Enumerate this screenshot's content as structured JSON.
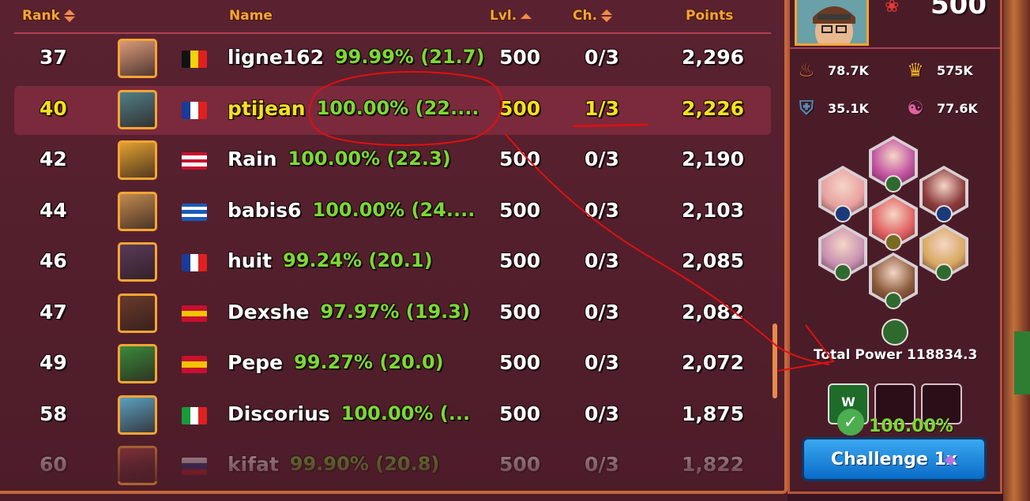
{
  "headers": {
    "rank": "Rank",
    "name": "Name",
    "level": "Lvl.",
    "challenges": "Ch.",
    "points": "Points"
  },
  "rows": [
    {
      "rank": "37",
      "name": "ligne162",
      "stat": "99.99% (21.7)",
      "level": "500",
      "challenges": "0/3",
      "points": "2,296",
      "flag": "be",
      "avatar_color": "#d89a7a",
      "highlight": false
    },
    {
      "rank": "40",
      "name": "ptijean",
      "stat": "100.00% (22....",
      "level": "500",
      "challenges": "1/3",
      "points": "2,226",
      "flag": "fr",
      "avatar_color": "#4f7f86",
      "highlight": true
    },
    {
      "rank": "42",
      "name": "Rain",
      "stat": "100.00% (22.3)",
      "level": "500",
      "challenges": "0/3",
      "points": "2,190",
      "flag": "my",
      "avatar_color": "#e0a030",
      "highlight": false
    },
    {
      "rank": "44",
      "name": "babis6",
      "stat": "100.00% (24....",
      "level": "500",
      "challenges": "0/3",
      "points": "2,103",
      "flag": "gr",
      "avatar_color": "#c08a50",
      "highlight": false
    },
    {
      "rank": "46",
      "name": "huit",
      "stat": "99.24% (20.1)",
      "level": "500",
      "challenges": "0/3",
      "points": "2,085",
      "flag": "fr",
      "avatar_color": "#5a3a5a",
      "highlight": false
    },
    {
      "rank": "47",
      "name": "Dexshe",
      "stat": "97.97% (19.3)",
      "level": "500",
      "challenges": "0/3",
      "points": "2,082",
      "flag": "es",
      "avatar_color": "#6a3a2a",
      "highlight": false
    },
    {
      "rank": "49",
      "name": "Pepe",
      "stat": "99.27% (20.0)",
      "level": "500",
      "challenges": "0/3",
      "points": "2,072",
      "flag": "es",
      "avatar_color": "#3a8a3a",
      "highlight": false
    },
    {
      "rank": "58",
      "name": "Discorius",
      "stat": "100.00% (...",
      "level": "500",
      "challenges": "0/3",
      "points": "1,875",
      "flag": "it",
      "avatar_color": "#5aa0c0",
      "highlight": false
    },
    {
      "rank": "60",
      "name": "kifat",
      "stat": "99.90% (20.8)",
      "level": "500",
      "challenges": "0/3",
      "points": "1,822",
      "flag": "ru",
      "avatar_color": "#b04a4a",
      "highlight": false
    }
  ],
  "profile": {
    "level": "500",
    "stats": [
      {
        "icon": "ego-icon",
        "value": "78.7K"
      },
      {
        "icon": "crown-icon",
        "value": "575K"
      },
      {
        "icon": "defense-icon",
        "value": "35.1K"
      },
      {
        "icon": "harmony-icon",
        "value": "77.6K"
      }
    ],
    "total_power": "Total Power 118834.3",
    "slot_label": "W",
    "win_chance": "100.00%",
    "challenge_label": "Challenge 1x"
  },
  "colors": {
    "accent": "#f6a534",
    "stat_green": "#7bd935",
    "highlight_text": "#f3e21a",
    "button_blue": "#0a6cc8"
  }
}
